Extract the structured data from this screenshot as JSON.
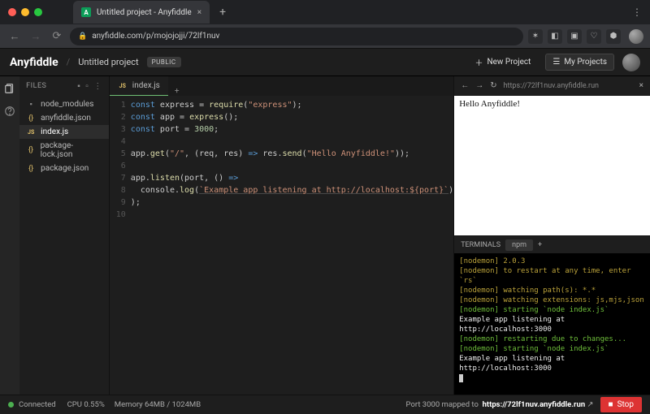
{
  "browser": {
    "tab_title": "Untitled project - Anyfiddle",
    "url": "anyfiddle.com/p/mojojojji/72lf1nuv"
  },
  "header": {
    "brand": "Anyfiddle",
    "project_name": "Untitled project",
    "visibility_badge": "PUBLIC",
    "new_project_label": "New Project",
    "my_projects_label": "My Projects"
  },
  "rail": {
    "items": [
      "Files",
      "Help"
    ]
  },
  "files": {
    "title": "FILES",
    "tree": [
      {
        "type": "folder",
        "name": "node_modules",
        "selected": false
      },
      {
        "type": "json",
        "name": "anyfiddle.json",
        "selected": false
      },
      {
        "type": "js",
        "name": "index.js",
        "selected": true
      },
      {
        "type": "json",
        "name": "package-lock.json",
        "selected": false
      },
      {
        "type": "json",
        "name": "package.json",
        "selected": false
      }
    ]
  },
  "editor": {
    "tab_label": "index.js",
    "line_count": 10
  },
  "preview": {
    "url": "https://72lf1nuv.anyfiddle.run",
    "content": "Hello Anyfiddle!"
  },
  "terminals": {
    "title": "TERMINALS",
    "tab": "npm",
    "lines": [
      {
        "c": "cY",
        "t": "[nodemon] 2.0.3"
      },
      {
        "c": "cY",
        "t": "[nodemon] to restart at any time, enter `rs`"
      },
      {
        "c": "cY",
        "t": "[nodemon] watching path(s): *.*"
      },
      {
        "c": "cY",
        "t": "[nodemon] watching extensions: js,mjs,json"
      },
      {
        "c": "cG",
        "t": "[nodemon] starting `node index.js`"
      },
      {
        "c": "cW",
        "t": "Example app listening at http://localhost:3000"
      },
      {
        "c": "cG",
        "t": "[nodemon] restarting due to changes..."
      },
      {
        "c": "cG",
        "t": "[nodemon] starting `node index.js`"
      },
      {
        "c": "cW",
        "t": "Example app listening at http://localhost:3000"
      }
    ]
  },
  "status": {
    "connected": "Connected",
    "cpu_label": "CPU",
    "cpu_value": "0.55%",
    "mem_label": "Memory",
    "mem_value": "64MB / 1024MB",
    "port_msg_prefix": "Port 3000 mapped to",
    "port_url": "https://72lf1nuv.anyfiddle.run",
    "stop_label": "Stop"
  }
}
